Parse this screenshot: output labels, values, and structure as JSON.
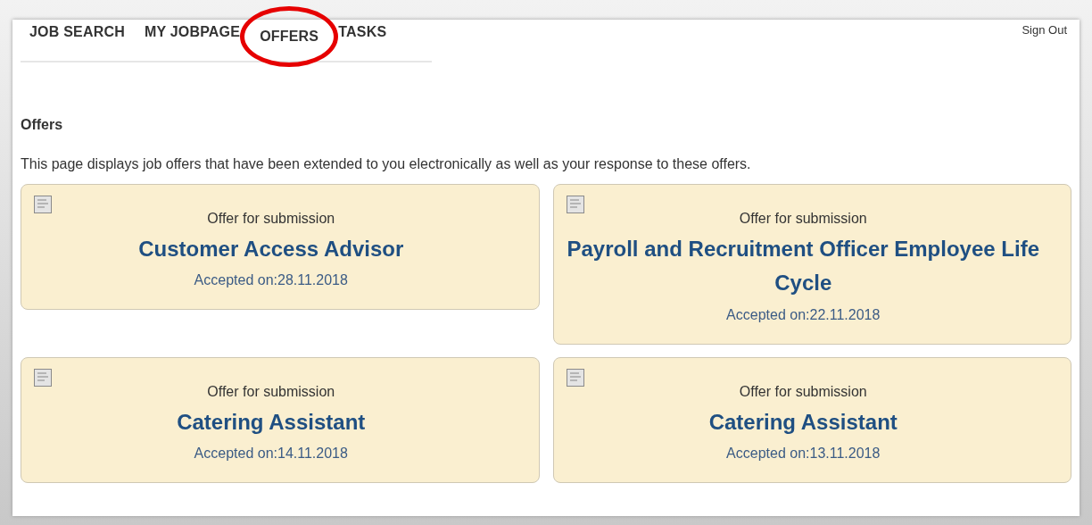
{
  "nav": {
    "items": [
      {
        "label": "JOB SEARCH",
        "circled": false
      },
      {
        "label": "MY JOBPAGE",
        "circled": false
      },
      {
        "label": "OFFERS",
        "circled": true
      },
      {
        "label": "TASKS",
        "circled": false
      }
    ],
    "sign_out": "Sign Out"
  },
  "page": {
    "heading": "Offers",
    "description": "This page displays job offers that have been extended to you electronically as well as your response to these offers."
  },
  "offers": [
    {
      "status": "Offer for submission",
      "title": "Customer Access Advisor",
      "accepted": "Accepted on:28.11.2018"
    },
    {
      "status": "Offer for submission",
      "title": "Payroll and Recruitment Officer Employee Life Cycle",
      "accepted": "Accepted on:22.11.2018"
    },
    {
      "status": "Offer for submission",
      "title": "Catering Assistant",
      "accepted": "Accepted on:14.11.2018"
    },
    {
      "status": "Offer for submission",
      "title": "Catering Assistant",
      "accepted": "Accepted on:13.11.2018"
    }
  ]
}
